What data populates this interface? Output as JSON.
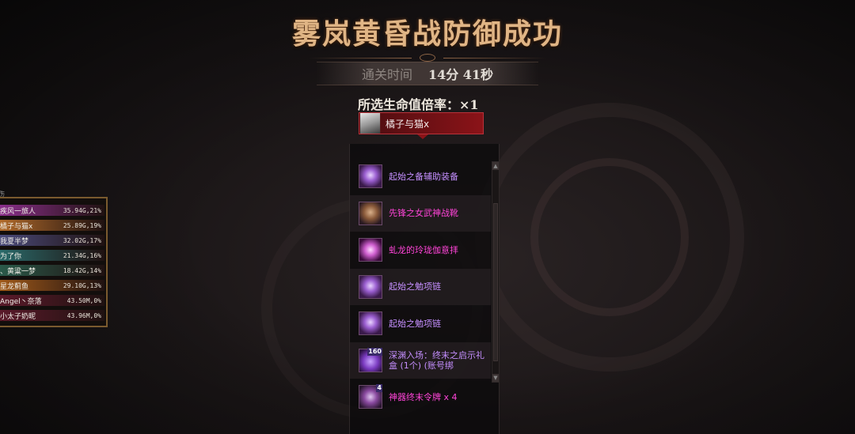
{
  "result": {
    "title": "雾岚黄昏战防御成功",
    "clear_label": "通关时间",
    "clear_time": "14分 41秒",
    "life_rate": "所选生命值倍率：×1"
  },
  "player": {
    "name": "橘子与猫x"
  },
  "loot": [
    {
      "name": "起始之备辅助装备",
      "icon": "orb-icon",
      "rarity": "unique",
      "badge": ""
    },
    {
      "name": "先锋之女武神战靴",
      "icon": "boots-icon",
      "rarity": "epic",
      "badge": ""
    },
    {
      "name": "虬龙的玲珑伽意拝",
      "icon": "ring-icon",
      "rarity": "epic",
      "badge": ""
    },
    {
      "name": "起始之勉项链",
      "icon": "necklace-icon",
      "rarity": "unique",
      "badge": ""
    },
    {
      "name": "起始之勉项链",
      "icon": "necklace-icon",
      "rarity": "unique",
      "badge": ""
    },
    {
      "name": "深渊入场：终末之启示礼盒 (1个) (账号绑",
      "icon": "gift-box-icon",
      "rarity": "unique",
      "badge": "160"
    },
    {
      "name": "神器终末令牌 x 4",
      "icon": "token-icon",
      "rarity": "epic",
      "badge": "4"
    }
  ],
  "damage_corner": "伤",
  "damage_board": [
    {
      "name": "疾风一旅人",
      "value": "35.94G,21%",
      "color": "#8a2f8a"
    },
    {
      "name": "橘子与猫x",
      "value": "25.89G,19%",
      "color": "#b06a2a"
    },
    {
      "name": "我夏半梦",
      "value": "32.02G,17%",
      "color": "#4a4a7a"
    },
    {
      "name": "为了你",
      "value": "21.34G,16%",
      "color": "#2a6a6a"
    },
    {
      "name": "、黄粱一梦",
      "value": "18.42G,14%",
      "color": "#2a5a4a"
    },
    {
      "name": "星龙蓟鱼",
      "value": "29.10G,13%",
      "color": "#a05a1a"
    },
    {
      "name": "Angel丶奈落",
      "value": "43.50M,0%",
      "color": "#5a1a2a"
    },
    {
      "name": "小太子奶昵",
      "value": "43.96M,0%",
      "color": "#5a1a2a"
    }
  ],
  "colors": {
    "title": "#e0b585",
    "epic_item": "#ff44d8",
    "unique_item": "#c58fff",
    "player_tag": "#8b1318"
  }
}
